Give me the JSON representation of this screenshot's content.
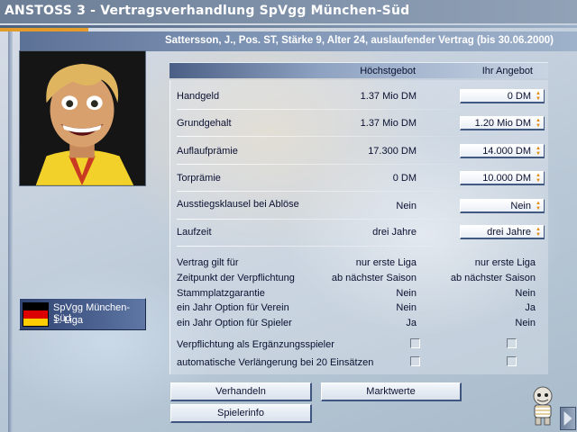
{
  "window": {
    "title": "ANSTOSS 3 - Vertragsverhandlung SpVgg München-Süd"
  },
  "player_info": "Sattersson, J., Pos. ST, Stärke 9, Alter 24, auslaufender Vertrag (bis 30.06.2000)",
  "columns": {
    "max_bid": "Höchstgebot",
    "your_offer": "Ihr Angebot"
  },
  "negotiable": [
    {
      "label": "Handgeld",
      "max": "1.37 Mio DM",
      "offer": "0 DM"
    },
    {
      "label": "Grundgehalt",
      "max": "1.37 Mio DM",
      "offer": "1.20 Mio DM"
    },
    {
      "label": "Auflaufprämie",
      "max": "17.300 DM",
      "offer": "14.000 DM"
    },
    {
      "label": "Torprämie",
      "max": "0 DM",
      "offer": "10.000 DM"
    },
    {
      "label": "Ausstiegsklausel bei Ablöse",
      "max": "Nein",
      "offer": "Nein"
    },
    {
      "label": "Laufzeit",
      "max": "drei Jahre",
      "offer": "drei Jahre"
    }
  ],
  "fixed": [
    {
      "label": "Vertrag gilt für",
      "max": "nur erste Liga",
      "offer": "nur erste Liga"
    },
    {
      "label": "Zeitpunkt der Verpflichtung",
      "max": "ab nächster Saison",
      "offer": "ab nächster Saison"
    },
    {
      "label": "Stammplatzgarantie",
      "max": "Nein",
      "offer": "Nein"
    },
    {
      "label": "ein Jahr Option für Verein",
      "max": "Nein",
      "offer": "Ja"
    },
    {
      "label": "ein Jahr Option für Spieler",
      "max": "Ja",
      "offer": "Nein"
    }
  ],
  "checkboxes": [
    {
      "label": "Verpflichtung als Ergänzungsspieler",
      "max_checked": false,
      "offer_checked": false
    },
    {
      "label": "automatische Verlängerung bei 20 Einsätzen",
      "max_checked": false,
      "offer_checked": false
    }
  ],
  "club": {
    "name": "SpVgg München-Süd",
    "league": "1. Liga",
    "flag_colors": [
      "#000000",
      "#dd0000",
      "#ffce00"
    ]
  },
  "buttons": {
    "negotiate": "Verhandeln",
    "market": "Marktwerte",
    "player_info": "Spielerinfo"
  },
  "icons": {
    "spinner": "up-down-arrows-icon",
    "mascot": "mascot-icon",
    "portrait": "player-portrait",
    "corner": "corner-arrow-icon"
  },
  "colors": {
    "title_bar": "#7b8da4",
    "accent_orange": "#e39b2a",
    "header_blue": "#5c7196"
  }
}
